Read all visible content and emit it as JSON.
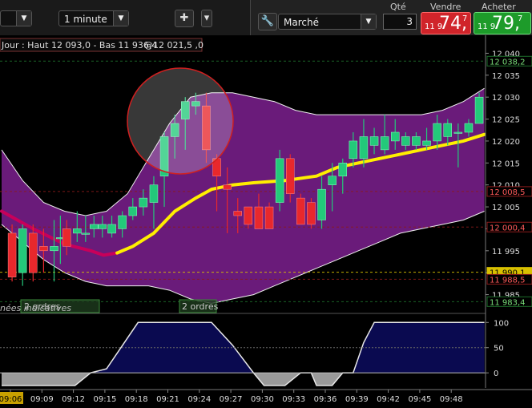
{
  "toolbar": {
    "period_value": "1 minute",
    "order_type": "Marché",
    "qty_label": "Qté",
    "qty_value": "3",
    "sell_label": "Vendre",
    "buy_label": "Acheter",
    "sell_price_small": "11 9",
    "sell_price_big": "74,",
    "sell_price_sup": "7",
    "buy_price_small": "11 9",
    "buy_price_big": "79,",
    "buy_price_sup": "7",
    "sell_color": "#d0242a",
    "buy_color": "#1d9b2a"
  },
  "info_bar": {
    "left_text": "Jour : Haut 12 093,0 - Bas 11 936,4",
    "right_text": "@12 021,5 ,0"
  },
  "labels": {
    "orders_left": "2 ordres",
    "orders_right": "2 ordres",
    "bottom_left": "nées indicatives"
  },
  "colors": {
    "envelope": "#6a1b7a",
    "ma_line": "#ffee00",
    "ma_line_start": "#c8005a",
    "bull": "#23c97a",
    "bear": "#e8282c",
    "oscillator": "#0a0a50",
    "oscillator_neg": "#9a9a9a"
  },
  "chart_data": {
    "type": "candlestick",
    "x_ticks": [
      "09:06",
      "09:09",
      "09:12",
      "09:15",
      "09:18",
      "09:21",
      "09:24",
      "09:27",
      "09:30",
      "09:33",
      "09:36",
      "09:39",
      "09:42",
      "09:45",
      "09:48"
    ],
    "y_ticks": [
      "12 040",
      "12 035",
      "12 030",
      "12 025",
      "12 020",
      "12 015",
      "12 010",
      "12 005",
      "12 000",
      "11 995",
      "11 990",
      "11 985"
    ],
    "ylim": [
      11982,
      12043
    ],
    "y_badges": [
      {
        "value": 12038.2,
        "label": "12 038,2",
        "color": "#1d6e2a"
      },
      {
        "value": 12008.5,
        "label": "12 008,5",
        "color": "#8b1a1a"
      },
      {
        "value": 12000.4,
        "label": "12 000,4",
        "color": "#8b1a1a"
      },
      {
        "value": 11990.1,
        "label": "11 990,1",
        "color": "#d8c000"
      },
      {
        "value": 11988.5,
        "label": "11 988,5",
        "color": "#8b1a1a"
      },
      {
        "value": 11983.4,
        "label": "11 983,4",
        "color": "#1d6e2a"
      }
    ],
    "candles": [
      {
        "t": 1.0,
        "o": 11999,
        "h": 12001,
        "l": 11988,
        "c": 11989
      },
      {
        "t": 2.0,
        "o": 11990,
        "h": 12001,
        "l": 11987,
        "c": 12000
      },
      {
        "t": 3.0,
        "o": 11999,
        "h": 12001,
        "l": 11988,
        "c": 11990
      },
      {
        "t": 4.0,
        "o": 11996,
        "h": 12000,
        "l": 11990,
        "c": 11995
      },
      {
        "t": 5.0,
        "o": 11995,
        "h": 12002,
        "l": 11988,
        "c": 11996
      },
      {
        "t": 5.6,
        "o": 11998,
        "h": 12003,
        "l": 11992,
        "c": 11998
      },
      {
        "t": 6.2,
        "o": 12000,
        "h": 12002,
        "l": 11994,
        "c": 11996
      },
      {
        "t": 7.2,
        "o": 11999,
        "h": 12004,
        "l": 11997,
        "c": 12000
      },
      {
        "t": 8.0,
        "o": 11999,
        "h": 12003,
        "l": 11997,
        "c": 11999
      },
      {
        "t": 8.8,
        "o": 12000,
        "h": 12003,
        "l": 11998,
        "c": 12001
      },
      {
        "t": 9.6,
        "o": 12000,
        "h": 12003,
        "l": 11998,
        "c": 12001
      },
      {
        "t": 10.5,
        "o": 11999,
        "h": 12003,
        "l": 11998,
        "c": 12001
      },
      {
        "t": 11.5,
        "o": 12000,
        "h": 12004,
        "l": 11998,
        "c": 12003
      },
      {
        "t": 12.5,
        "o": 12003,
        "h": 12007,
        "l": 12002,
        "c": 12005
      },
      {
        "t": 13.5,
        "o": 12005,
        "h": 12009,
        "l": 12003,
        "c": 12007
      },
      {
        "t": 14.5,
        "o": 12006,
        "h": 12012,
        "l": 12000,
        "c": 12010
      },
      {
        "t": 15.5,
        "o": 12012,
        "h": 12022,
        "l": 12005,
        "c": 12021
      },
      {
        "t": 16.5,
        "o": 12021,
        "h": 12026,
        "l": 12016,
        "c": 12024
      },
      {
        "t": 17.5,
        "o": 12025,
        "h": 12030,
        "l": 12018,
        "c": 12029
      },
      {
        "t": 18.5,
        "o": 12028,
        "h": 12031,
        "l": 12026,
        "c": 12029
      },
      {
        "t": 19.5,
        "o": 12028,
        "h": 12031,
        "l": 12015,
        "c": 12018
      },
      {
        "t": 20.5,
        "o": 12016,
        "h": 12017,
        "l": 12004,
        "c": 12012
      },
      {
        "t": 21.5,
        "o": 12010,
        "h": 12014,
        "l": 11999,
        "c": 12009
      },
      {
        "t": 22.5,
        "o": 12004,
        "h": 12007,
        "l": 11999,
        "c": 12003
      },
      {
        "t": 23.5,
        "o": 12005,
        "h": 12005,
        "l": 12000,
        "c": 12001
      },
      {
        "t": 24.5,
        "o": 12005,
        "h": 12008,
        "l": 12000,
        "c": 12000
      },
      {
        "t": 25.5,
        "o": 12005,
        "h": 12006,
        "l": 12000,
        "c": 12000
      },
      {
        "t": 26.5,
        "o": 12006,
        "h": 12018,
        "l": 12004,
        "c": 12016
      },
      {
        "t": 27.5,
        "o": 12016,
        "h": 12017,
        "l": 12006,
        "c": 12008
      },
      {
        "t": 28.5,
        "o": 12007,
        "h": 12008,
        "l": 12001,
        "c": 12001
      },
      {
        "t": 29.5,
        "o": 12006,
        "h": 12007,
        "l": 12000,
        "c": 12001
      },
      {
        "t": 30.5,
        "o": 12002,
        "h": 12012,
        "l": 12000,
        "c": 12009
      },
      {
        "t": 31.5,
        "o": 12010,
        "h": 12015,
        "l": 12004,
        "c": 12012
      },
      {
        "t": 32.5,
        "o": 12012,
        "h": 12016,
        "l": 12008,
        "c": 12015
      },
      {
        "t": 33.5,
        "o": 12016,
        "h": 12022,
        "l": 12014,
        "c": 12020
      },
      {
        "t": 34.5,
        "o": 12016,
        "h": 12025,
        "l": 12014,
        "c": 12021
      },
      {
        "t": 35.5,
        "o": 12019,
        "h": 12023,
        "l": 12017,
        "c": 12021
      },
      {
        "t": 36.5,
        "o": 12018,
        "h": 12026,
        "l": 12017,
        "c": 12021
      },
      {
        "t": 37.5,
        "o": 12020,
        "h": 12025,
        "l": 12018,
        "c": 12022
      },
      {
        "t": 38.5,
        "o": 12019,
        "h": 12022,
        "l": 12018,
        "c": 12021
      },
      {
        "t": 39.5,
        "o": 12019,
        "h": 12022,
        "l": 12018,
        "c": 12021
      },
      {
        "t": 40.5,
        "o": 12019,
        "h": 12023,
        "l": 12018,
        "c": 12020
      },
      {
        "t": 41.5,
        "o": 12020,
        "h": 12026,
        "l": 12018,
        "c": 12024
      },
      {
        "t": 42.5,
        "o": 12021,
        "h": 12025,
        "l": 12019,
        "c": 12024
      },
      {
        "t": 43.5,
        "o": 12022,
        "h": 12024,
        "l": 12014,
        "c": 12022
      },
      {
        "t": 44.5,
        "o": 12022,
        "h": 12025,
        "l": 12021,
        "c": 12024
      },
      {
        "t": 45.5,
        "o": 12024,
        "h": 12031,
        "l": 12024,
        "c": 12030
      }
    ],
    "ma_line": [
      [
        0,
        12004
      ],
      [
        3,
        12000
      ],
      [
        6,
        11996.5
      ],
      [
        8.5,
        11995
      ],
      [
        9.7,
        11994
      ],
      [
        11,
        11994.5
      ],
      [
        12.5,
        11996
      ],
      [
        14.5,
        11999
      ],
      [
        16.5,
        12004
      ],
      [
        18.5,
        12007
      ],
      [
        20,
        12009
      ],
      [
        22,
        12010
      ],
      [
        24,
        12010.5
      ],
      [
        27,
        12011
      ],
      [
        30,
        12012
      ],
      [
        32,
        12014
      ],
      [
        35,
        12015.5
      ],
      [
        38,
        12017
      ],
      [
        41,
        12018.5
      ],
      [
        44,
        12020
      ],
      [
        46,
        12021.5
      ]
    ],
    "envelope_upper": [
      [
        0,
        12018
      ],
      [
        2,
        12011
      ],
      [
        4,
        12006
      ],
      [
        6,
        12004
      ],
      [
        8,
        12003
      ],
      [
        10,
        12004
      ],
      [
        12,
        12008
      ],
      [
        14,
        12016
      ],
      [
        16,
        12024
      ],
      [
        18,
        12030
      ],
      [
        20,
        12031
      ],
      [
        22,
        12031
      ],
      [
        24,
        12030
      ],
      [
        26,
        12029
      ],
      [
        28,
        12027
      ],
      [
        30,
        12026
      ],
      [
        32,
        12026
      ],
      [
        34,
        12026
      ],
      [
        36,
        12026
      ],
      [
        38,
        12026
      ],
      [
        40,
        12026
      ],
      [
        42,
        12027
      ],
      [
        44,
        12029
      ],
      [
        46,
        12032
      ]
    ],
    "envelope_lower": [
      [
        0,
        12001
      ],
      [
        2,
        11997
      ],
      [
        4,
        11993
      ],
      [
        6,
        11990
      ],
      [
        8,
        11988
      ],
      [
        10,
        11987
      ],
      [
        12,
        11987
      ],
      [
        14,
        11987
      ],
      [
        16,
        11986
      ],
      [
        18,
        11984
      ],
      [
        20,
        11983
      ],
      [
        22,
        11984
      ],
      [
        24,
        11985
      ],
      [
        26,
        11987
      ],
      [
        28,
        11989
      ],
      [
        30,
        11991
      ],
      [
        32,
        11993
      ],
      [
        34,
        11995
      ],
      [
        36,
        11997
      ],
      [
        38,
        11999
      ],
      [
        40,
        12000
      ],
      [
        42,
        12001
      ],
      [
        44,
        12002
      ],
      [
        46,
        12004
      ]
    ],
    "oscillator_ylim": [
      -30,
      110
    ],
    "oscillator_ticks": [
      100,
      50,
      0
    ],
    "oscillator": [
      [
        0,
        -25
      ],
      [
        7,
        -25
      ],
      [
        8.5,
        0
      ],
      [
        10,
        8
      ],
      [
        13,
        100
      ],
      [
        18,
        100
      ],
      [
        20,
        100
      ],
      [
        22,
        55
      ],
      [
        24,
        0
      ],
      [
        25,
        -25
      ],
      [
        27,
        -25
      ],
      [
        28.5,
        0
      ],
      [
        29.5,
        0
      ],
      [
        30,
        -25
      ],
      [
        31.5,
        -25
      ],
      [
        32.5,
        0
      ],
      [
        33.5,
        0
      ],
      [
        34.5,
        60
      ],
      [
        35.5,
        100
      ],
      [
        46,
        100
      ]
    ]
  }
}
